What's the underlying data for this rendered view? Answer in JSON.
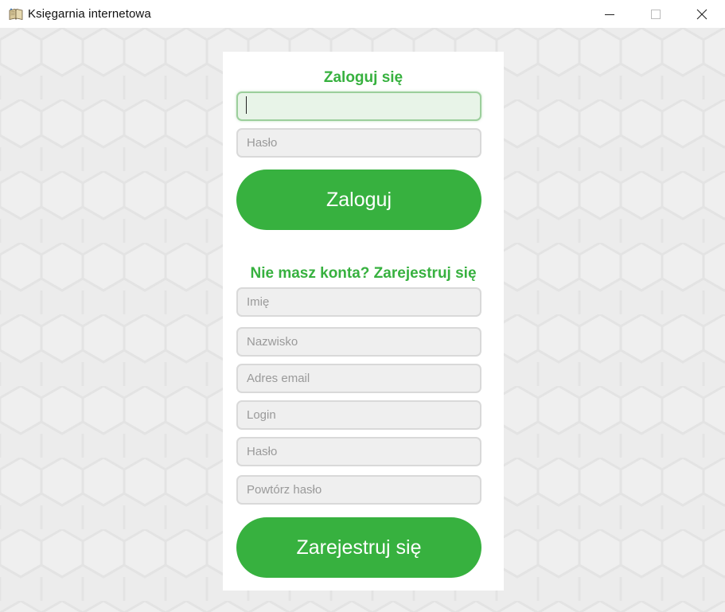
{
  "window": {
    "title": "Księgarnia internetowa",
    "icon": "book-icon",
    "controls": [
      "minimize-icon",
      "maximize-icon",
      "close-icon"
    ]
  },
  "colors": {
    "accent": "#37b13f",
    "panel": "#ffffff",
    "field_bg": "#efefef",
    "field_border": "#d9d9d9",
    "focused_field_bg": "#e8f4e8"
  },
  "login": {
    "heading": "Zaloguj się",
    "login_field": {
      "value": "",
      "placeholder": ""
    },
    "password_field": {
      "value": "",
      "placeholder": "Hasło"
    },
    "submit_label": "Zaloguj"
  },
  "register": {
    "heading": "Nie masz konta? Zarejestruj się",
    "first_name": {
      "placeholder": "Imię"
    },
    "last_name": {
      "placeholder": "Nazwisko"
    },
    "email": {
      "placeholder": "Adres email"
    },
    "login": {
      "placeholder": "Login"
    },
    "password": {
      "placeholder": "Hasło"
    },
    "repeat_password": {
      "placeholder": "Powtórz hasło"
    },
    "submit_label": "Zarejestruj się"
  }
}
